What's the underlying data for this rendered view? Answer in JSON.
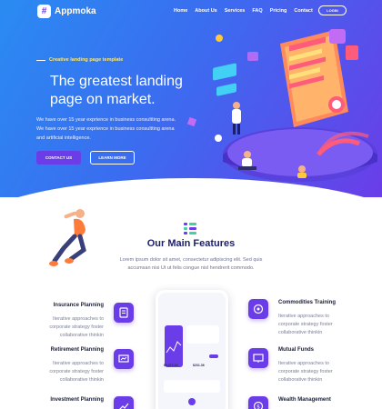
{
  "brand": {
    "name": "Appmoka",
    "mark": "#"
  },
  "nav": {
    "items": [
      "Home",
      "About Us",
      "Services",
      "FAQ",
      "Pricing",
      "Contact"
    ],
    "login": "LOGIN"
  },
  "hero": {
    "eyebrow": "Creative landing page template",
    "title": "The greatest landing page on market.",
    "description": "We have over 15 year exprience in business consultting arena. We have over 15 year exprience in business consultting arena and artificial intelligence.",
    "primary_cta": "CONTACT US",
    "secondary_cta": "LEARN MORE"
  },
  "features": {
    "title": "Our Main Features",
    "description": "Lorem ipsum dolor sit amet, consectetur adipiscing elit. Sed quis accumsan nisi Ut ut felis congue nisl hendrerit commodo.",
    "items": [
      {
        "title": "Insurance Planning",
        "desc": "Iterative approaches to corporate strategy foster collaborative thinkin",
        "icon": "document-icon"
      },
      {
        "title": "Retirement Planning",
        "desc": "Iterative approaches to corporate strategy foster collaborative thinkin",
        "icon": "chart-icon"
      },
      {
        "title": "Investment Planning",
        "desc": "",
        "icon": "growth-icon"
      },
      {
        "title": "Commodities Training",
        "desc": "Iterative approaches to corporate strategy foster collaborative thinkin",
        "icon": "target-icon"
      },
      {
        "title": "Mutual Funds",
        "desc": "Iterative approaches to corporate strategy foster collaborative thinkin",
        "icon": "presentation-icon"
      },
      {
        "title": "Wealth Management",
        "desc": "",
        "icon": "money-icon"
      }
    ]
  },
  "phone": {
    "values": [
      "$9,672.03",
      "$231.36"
    ]
  },
  "colors": {
    "accent": "#6a3de8",
    "hero_start": "#2a8bf2",
    "hero_end": "#6a3de8",
    "title": "#1c1f6a",
    "highlight": "#ffe76a"
  }
}
